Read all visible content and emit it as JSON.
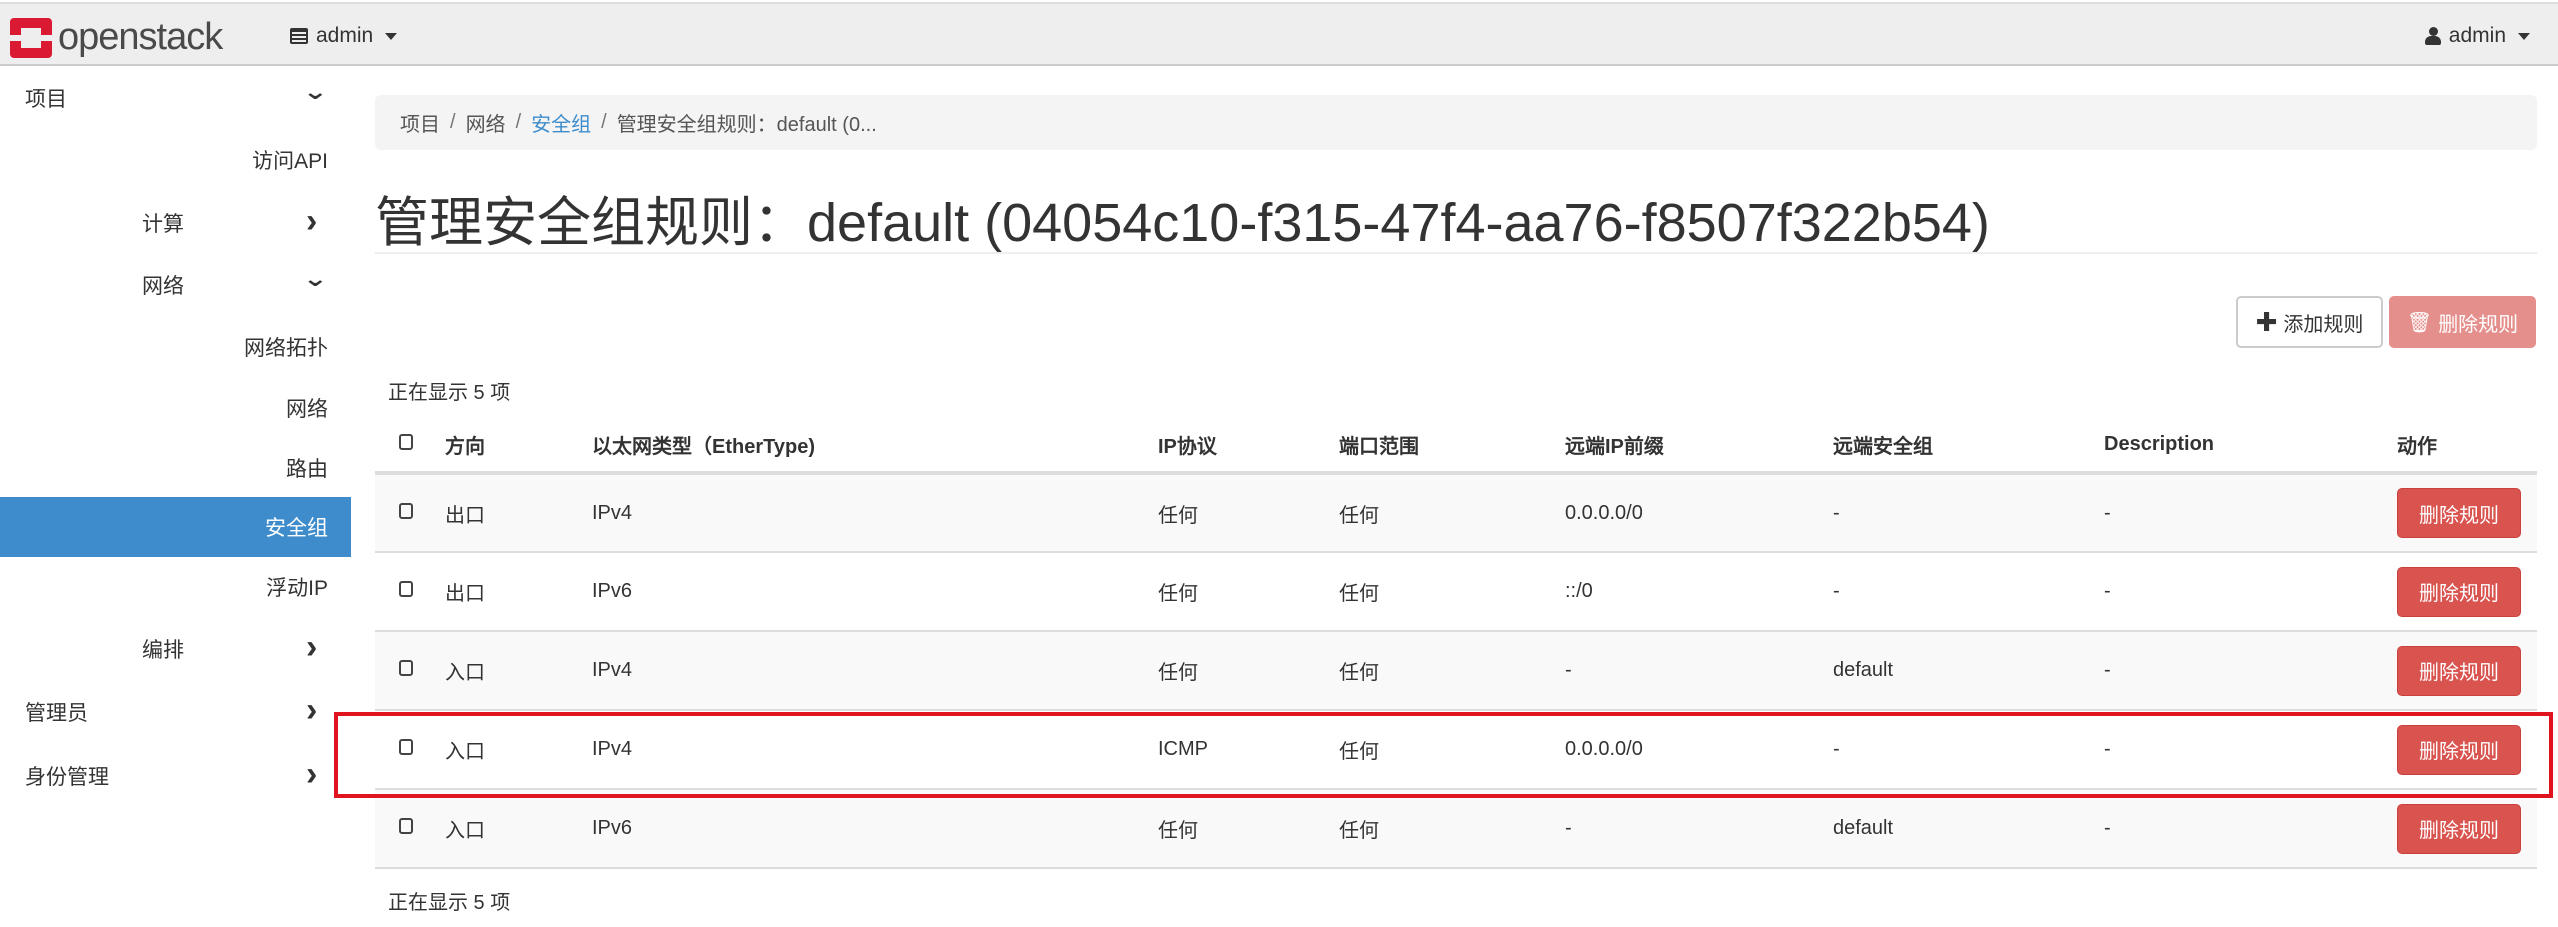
{
  "header": {
    "logo": "openstack",
    "project": "admin",
    "user": "admin"
  },
  "sidebar": {
    "items": [
      {
        "label": "项目",
        "chevron": "v"
      },
      {
        "label": "访问API"
      },
      {
        "label": "计算",
        "chevron": ">"
      },
      {
        "label": "网络",
        "chevron": "v"
      },
      {
        "label": "网络拓扑"
      },
      {
        "label": "网络"
      },
      {
        "label": "路由"
      },
      {
        "label": "安全组",
        "active": true
      },
      {
        "label": "浮动IP"
      },
      {
        "label": "编排",
        "chevron": ">"
      },
      {
        "label": "管理员",
        "chevron": ">"
      },
      {
        "label": "身份管理",
        "chevron": ">"
      }
    ]
  },
  "breadcrumb": [
    "项目",
    "网络",
    "安全组",
    "管理安全组规则：default (0..."
  ],
  "title": "管理安全组规则：default (04054c10-f315-47f4-aa76-f8507f322b54)",
  "actions": {
    "add": "添加规则",
    "delete": "删除规则"
  },
  "count_text": "正在显示 5 项",
  "table": {
    "headers": [
      "方向",
      "以太网类型（EtherType)",
      "IP协议",
      "端口范围",
      "远端IP前缀",
      "远端安全组",
      "Description",
      "动作"
    ],
    "rows": [
      [
        "出口",
        "IPv4",
        "任何",
        "任何",
        "0.0.0.0/0",
        "-",
        "-",
        "删除规则"
      ],
      [
        "出口",
        "IPv6",
        "任何",
        "任何",
        "::/0",
        "-",
        "-",
        "删除规则"
      ],
      [
        "入口",
        "IPv4",
        "任何",
        "任何",
        "-",
        "default",
        "-",
        "删除规则"
      ],
      [
        "入口",
        "IPv4",
        "ICMP",
        "任何",
        "0.0.0.0/0",
        "-",
        "-",
        "删除规则"
      ],
      [
        "入口",
        "IPv6",
        "任何",
        "任何",
        "-",
        "default",
        "-",
        "删除规则"
      ]
    ]
  },
  "colors": {
    "accent": "#3e8ccc",
    "danger": "#d9534f",
    "highlight": "#e0141e",
    "brand": "#da1a32"
  }
}
